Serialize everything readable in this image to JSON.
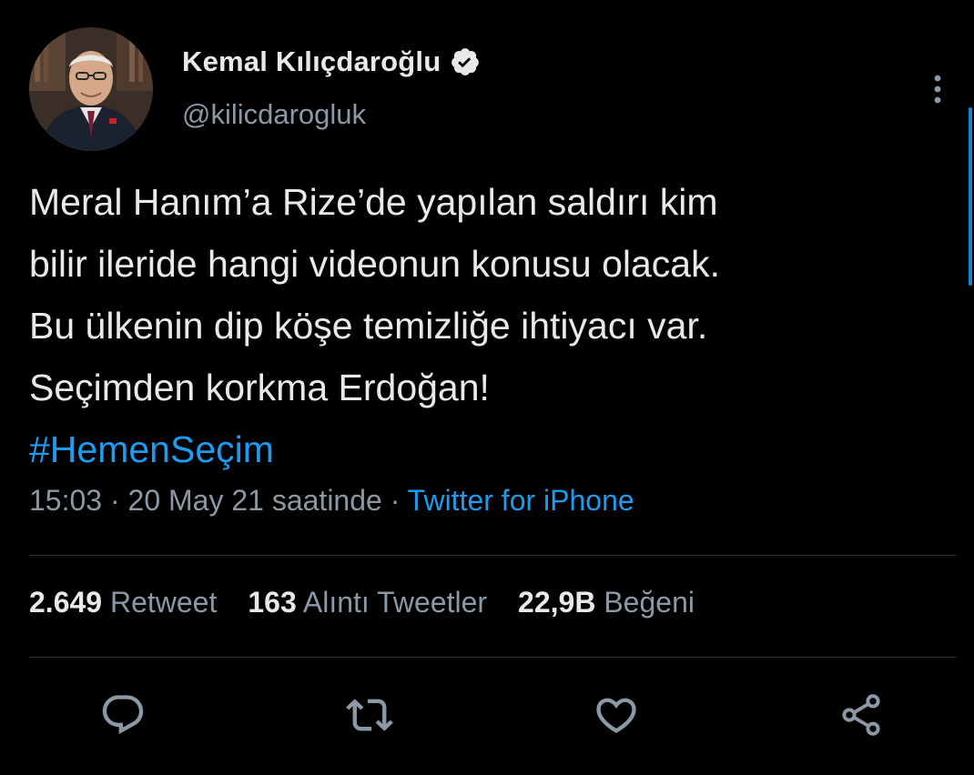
{
  "user": {
    "display_name": "Kemal Kılıçdaroğlu",
    "handle": "@kilicdarogluk",
    "verified": true
  },
  "tweet": {
    "lines": [
      "Meral Hanım’a Rize’de yapılan saldırı kim",
      "bilir ileride hangi videonun konusu olacak.",
      "Bu ülkenin dip köşe temizliğe ihtiyacı var.",
      "Seçimden korkma Erdoğan!"
    ],
    "hashtag": "#HemenSeçim"
  },
  "meta": {
    "time": "15:03",
    "sep1": " · ",
    "date": "20 May 21 saatinde",
    "sep2": " · ",
    "source": "Twitter for iPhone"
  },
  "stats": [
    {
      "count": "2.649",
      "label": "Retweet"
    },
    {
      "count": "163",
      "label": "Alıntı Tweetler"
    },
    {
      "count": "22,9B",
      "label": "Beğeni"
    }
  ],
  "actions": [
    "reply-icon",
    "retweet-icon",
    "like-icon",
    "share-icon"
  ],
  "colors": {
    "background": "#000000",
    "text": "#e7e9ea",
    "secondary": "#8b98a5",
    "link": "#1d9bf0",
    "divider": "#2f3336"
  }
}
